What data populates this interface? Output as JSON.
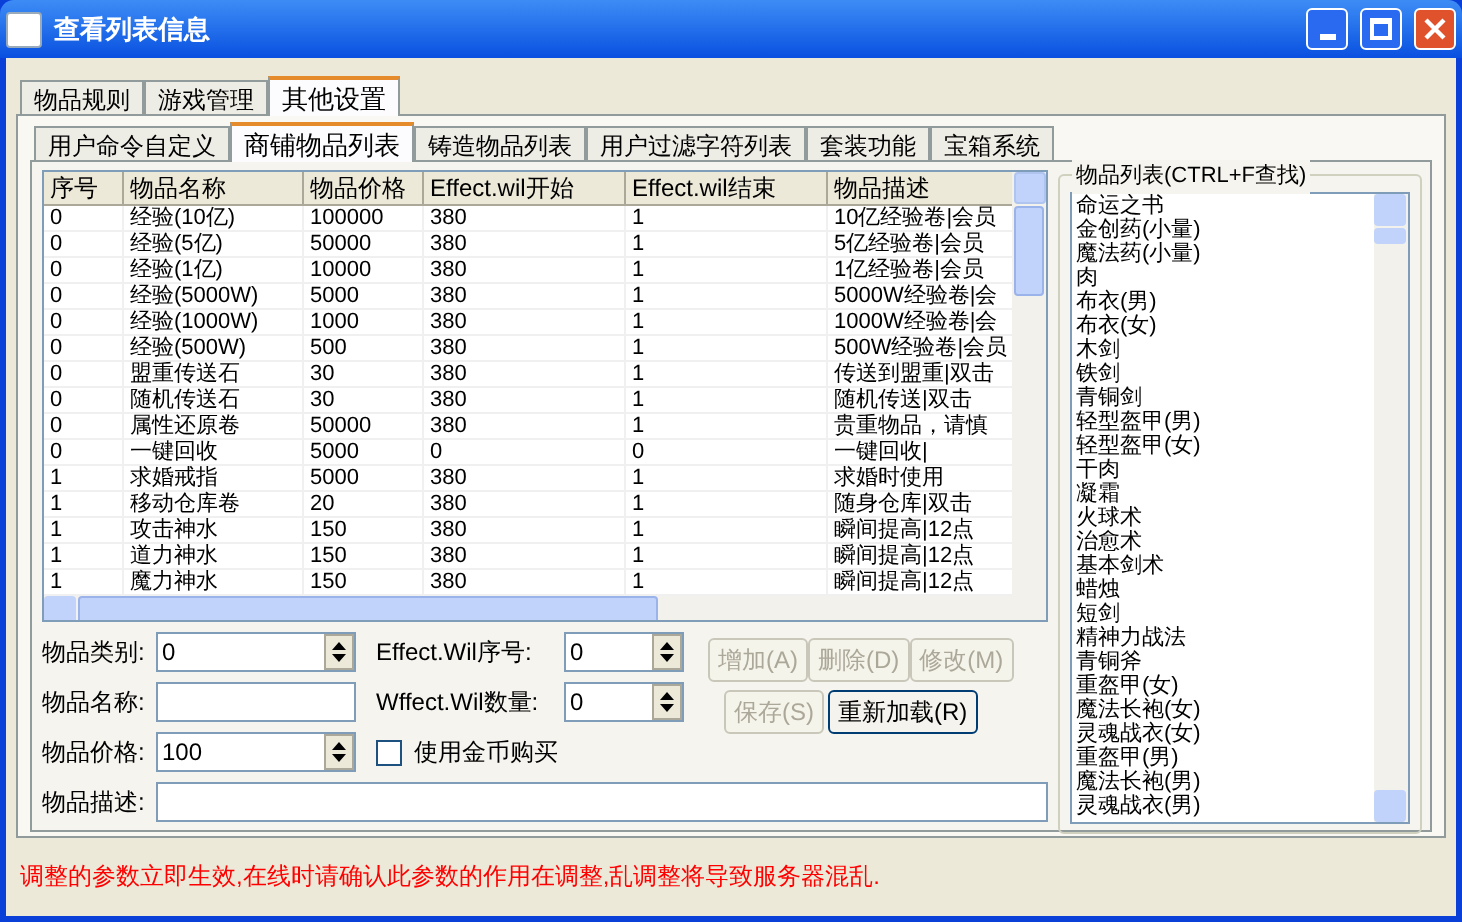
{
  "window": {
    "title": "查看列表信息"
  },
  "tabs": [
    {
      "label": "物品规则",
      "selected": false
    },
    {
      "label": "游戏管理",
      "selected": false
    },
    {
      "label": "其他设置",
      "selected": true
    }
  ],
  "subtabs": [
    {
      "label": "用户命令自定义",
      "selected": false
    },
    {
      "label": "商铺物品列表",
      "selected": true
    },
    {
      "label": "铸造物品列表",
      "selected": false
    },
    {
      "label": "用户过滤字符列表",
      "selected": false
    },
    {
      "label": "套装功能",
      "selected": false
    },
    {
      "label": "宝箱系统",
      "selected": false
    }
  ],
  "table": {
    "columns": [
      "序号",
      "物品名称",
      "物品价格",
      "Effect.wil开始",
      "Effect.wil结束",
      "物品描述"
    ],
    "rows": [
      [
        "0",
        "经验(10亿)",
        "100000",
        "380",
        "1",
        "10亿经验卷|会员"
      ],
      [
        "0",
        "经验(5亿)",
        "50000",
        "380",
        "1",
        "5亿经验卷|会员"
      ],
      [
        "0",
        "经验(1亿)",
        "10000",
        "380",
        "1",
        "1亿经验卷|会员"
      ],
      [
        "0",
        "经验(5000W)",
        "5000",
        "380",
        "1",
        "5000W经验卷|会"
      ],
      [
        "0",
        "经验(1000W)",
        "1000",
        "380",
        "1",
        "1000W经验卷|会"
      ],
      [
        "0",
        "经验(500W)",
        "500",
        "380",
        "1",
        "500W经验卷|会员"
      ],
      [
        "0",
        "盟重传送石",
        "30",
        "380",
        "1",
        "传送到盟重|双击"
      ],
      [
        "0",
        "随机传送石",
        "30",
        "380",
        "1",
        "随机传送|双击"
      ],
      [
        "0",
        "属性还原卷",
        "50000",
        "380",
        "1",
        "贵重物品，请慎"
      ],
      [
        "0",
        "一键回收",
        "5000",
        "0",
        "0",
        "一键回收|"
      ],
      [
        "1",
        "求婚戒指",
        "5000",
        "380",
        "1",
        "求婚时使用"
      ],
      [
        "1",
        "移动仓库卷",
        "20",
        "380",
        "1",
        "随身仓库|双击"
      ],
      [
        "1",
        "攻击神水",
        "150",
        "380",
        "1",
        "瞬间提高|12点"
      ],
      [
        "1",
        "道力神水",
        "150",
        "380",
        "1",
        "瞬间提高|12点"
      ],
      [
        "1",
        "魔力神水",
        "150",
        "380",
        "1",
        "瞬间提高|12点"
      ]
    ]
  },
  "form": {
    "fields": [
      {
        "kind": "spin",
        "label": "物品类别:",
        "value": "0"
      },
      {
        "kind": "spin",
        "label": "Effect.Wil序号:",
        "value": "0"
      },
      {
        "kind": "text",
        "label": "物品名称:"
      },
      {
        "kind": "spin",
        "label": "Wffect.Wil数量:",
        "value": "0"
      },
      {
        "kind": "spin",
        "label": "物品价格:",
        "value": "100"
      },
      {
        "kind": "check",
        "label": "使用金币购买",
        "checked": false
      },
      {
        "kind": "wide",
        "label": "物品描述:"
      }
    ],
    "buttons": [
      {
        "label": "增加(A)",
        "disabled": true
      },
      {
        "label": "删除(D)",
        "disabled": true
      },
      {
        "label": "修改(M)",
        "disabled": true
      },
      {
        "label": "保存(S)",
        "disabled": true
      },
      {
        "label": "重新加载(R)",
        "disabled": false
      }
    ]
  },
  "item_list": {
    "title": "物品列表(CTRL+F查找)",
    "items": [
      "命运之书",
      "金创药(小量)",
      "魔法药(小量)",
      "肉",
      "布衣(男)",
      "布衣(女)",
      "木剑",
      "铁剑",
      "青铜剑",
      "轻型盔甲(男)",
      "轻型盔甲(女)",
      "干肉",
      "凝霜",
      "火球术",
      "治愈术",
      "基本剑术",
      "蜡烛",
      "短剑",
      "精神力战法",
      "青铜斧",
      "重盔甲(女)",
      "魔法长袍(女)",
      "灵魂战衣(女)",
      "重盔甲(男)",
      "魔法长袍(男)",
      "灵魂战衣(男)"
    ]
  },
  "status_bar": "调整的参数立即生效,在线时请确认此参数的作用在调整,乱调整将导致服务器混乱."
}
